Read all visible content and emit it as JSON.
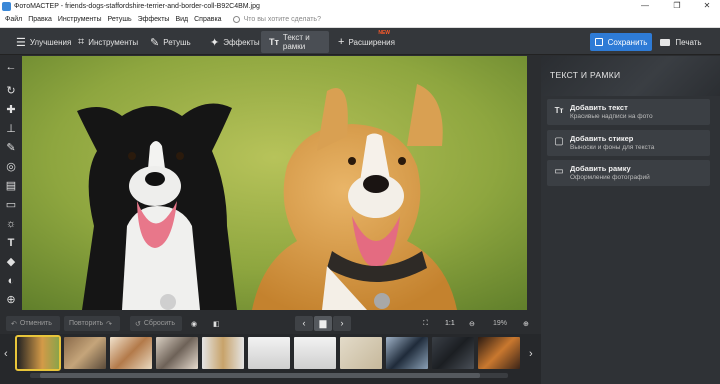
{
  "window": {
    "title": "ФотоМАСТЕР - friends-dogs-staffordshire-terrier-and-border-coll-B92C4BM.jpg",
    "minimize": "—",
    "maximize": "❐",
    "close": "✕"
  },
  "menu": {
    "items": [
      "Файл",
      "Правка",
      "Инструменты",
      "Ретушь",
      "Эффекты",
      "Вид",
      "Справка"
    ],
    "search_placeholder": "Что вы хотите сделать?"
  },
  "toolbar": {
    "tabs": [
      {
        "label": "Улучшения",
        "icon": "sliders-icon"
      },
      {
        "label": "Инструменты",
        "icon": "crop-icon"
      },
      {
        "label": "Ретушь",
        "icon": "brush-icon"
      },
      {
        "label": "Эффекты",
        "icon": "magic-wand-icon"
      },
      {
        "label": "Текст и рамки",
        "icon": "text-icon",
        "active": true
      },
      {
        "label": "Расширения",
        "icon": "plus-icon",
        "badge": "NEW"
      }
    ],
    "save_label": "Сохранить",
    "print_label": "Печать"
  },
  "panel": {
    "title": "ТЕКСТ И РАМКИ",
    "cards": [
      {
        "title": "Добавить текст",
        "subtitle": "Красивые надписи на фото",
        "icon": "text-icon"
      },
      {
        "title": "Добавить стикер",
        "subtitle": "Выноски и фоны для текста",
        "icon": "sticker-icon"
      },
      {
        "title": "Добавить рамку",
        "subtitle": "Оформление фотографий",
        "icon": "frame-icon"
      }
    ]
  },
  "bottom": {
    "undo_label": "Отменить",
    "redo_label": "Повторить",
    "reset_label": "Сбросить",
    "zoom_ratio": "1:1",
    "zoom_percent": "19%"
  },
  "colors": {
    "accent": "#2e7bd6",
    "new_badge": "#ff5a2a"
  }
}
